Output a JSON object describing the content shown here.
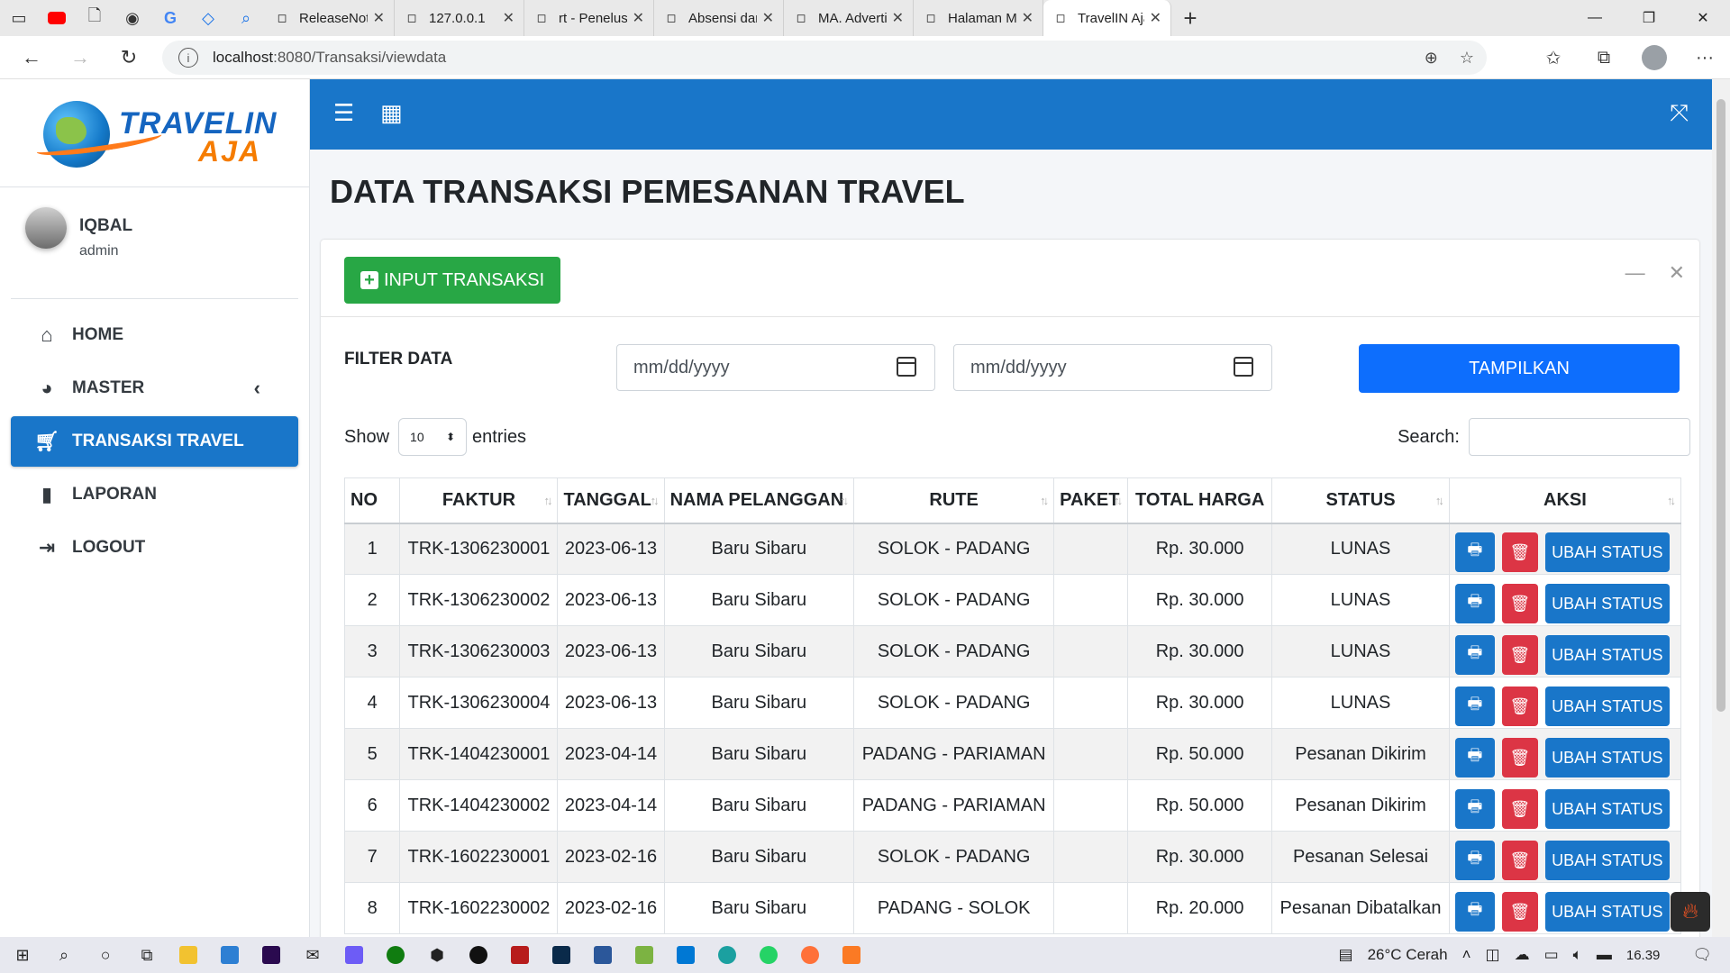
{
  "browser": {
    "tabs": [
      {
        "title": "ReleaseNote",
        "icon": "document-icon"
      },
      {
        "title": "127.0.0.1",
        "icon": "refresh-document-icon"
      },
      {
        "title": "rt - Penelusu",
        "icon": "google-icon"
      },
      {
        "title": "Absensi dan",
        "icon": "ma-logo-icon"
      },
      {
        "title": "MA. Advertis",
        "icon": "ma-logo-icon"
      },
      {
        "title": "Halaman Ma",
        "icon": "globe-icon"
      },
      {
        "title": "TravelIN Aja",
        "icon": "document-icon"
      }
    ],
    "url_host": "localhost",
    "url_path": ":8080/Transaksi/viewdata"
  },
  "app": {
    "logo_line1": "TRAVELIN",
    "logo_line2": "AJA",
    "user": {
      "name": "IQBAL",
      "role": "admin"
    },
    "menu": [
      {
        "label": "HOME",
        "icon": "home-icon"
      },
      {
        "label": "MASTER",
        "icon": "dashboard-icon"
      },
      {
        "label": "TRANSAKSI TRAVEL",
        "icon": "cart-icon"
      },
      {
        "label": "LAPORAN",
        "icon": "file-icon"
      },
      {
        "label": "LOGOUT",
        "icon": "logout-icon"
      }
    ]
  },
  "page": {
    "title": "DATA TRANSAKSI PEMESANAN TRAVEL",
    "input_button": "INPUT TRANSAKSI",
    "filter_label": "FILTER DATA",
    "date_from_placeholder": "mm/dd/yyyy",
    "date_to_placeholder": "mm/dd/yyyy",
    "tampilkan_button": "TAMPILKAN",
    "show_label": "Show",
    "entries_value": "10",
    "entries_label": "entries",
    "search_label": "Search:"
  },
  "table": {
    "columns": [
      "NO",
      "FAKTUR",
      "TANGGAL",
      "NAMA PELANGGAN",
      "RUTE",
      "PAKET",
      "TOTAL HARGA",
      "STATUS",
      "AKSI"
    ],
    "action_label": "UBAH STATUS",
    "rows": [
      {
        "no": "1",
        "faktur": "TRK-1306230001",
        "tanggal": "2023-06-13",
        "nama": "Baru Sibaru",
        "rute": "SOLOK - PADANG",
        "paket": "",
        "total": "Rp. 30.000",
        "status": "LUNAS"
      },
      {
        "no": "2",
        "faktur": "TRK-1306230002",
        "tanggal": "2023-06-13",
        "nama": "Baru Sibaru",
        "rute": "SOLOK - PADANG",
        "paket": "",
        "total": "Rp. 30.000",
        "status": "LUNAS"
      },
      {
        "no": "3",
        "faktur": "TRK-1306230003",
        "tanggal": "2023-06-13",
        "nama": "Baru Sibaru",
        "rute": "SOLOK - PADANG",
        "paket": "",
        "total": "Rp. 30.000",
        "status": "LUNAS"
      },
      {
        "no": "4",
        "faktur": "TRK-1306230004",
        "tanggal": "2023-06-13",
        "nama": "Baru Sibaru",
        "rute": "SOLOK - PADANG",
        "paket": "",
        "total": "Rp. 30.000",
        "status": "LUNAS"
      },
      {
        "no": "5",
        "faktur": "TRK-1404230001",
        "tanggal": "2023-04-14",
        "nama": "Baru Sibaru",
        "rute": "PADANG - PARIAMAN",
        "paket": "",
        "total": "Rp. 50.000",
        "status": "Pesanan Dikirim"
      },
      {
        "no": "6",
        "faktur": "TRK-1404230002",
        "tanggal": "2023-04-14",
        "nama": "Baru Sibaru",
        "rute": "PADANG - PARIAMAN",
        "paket": "",
        "total": "Rp. 50.000",
        "status": "Pesanan Dikirim"
      },
      {
        "no": "7",
        "faktur": "TRK-1602230001",
        "tanggal": "2023-02-16",
        "nama": "Baru Sibaru",
        "rute": "SOLOK - PADANG",
        "paket": "",
        "total": "Rp. 30.000",
        "status": "Pesanan Selesai"
      },
      {
        "no": "8",
        "faktur": "TRK-1602230002",
        "tanggal": "2023-02-16",
        "nama": "Baru Sibaru",
        "rute": "PADANG - SOLOK",
        "paket": "",
        "total": "Rp. 20.000",
        "status": "Pesanan Dibatalkan"
      }
    ]
  },
  "taskbar": {
    "weather": "26°C  Cerah",
    "time": "16.39"
  },
  "colors": {
    "primary": "#1976c9",
    "success": "#28a745",
    "danger": "#dc3545",
    "button_blue": "#0d6efd"
  }
}
